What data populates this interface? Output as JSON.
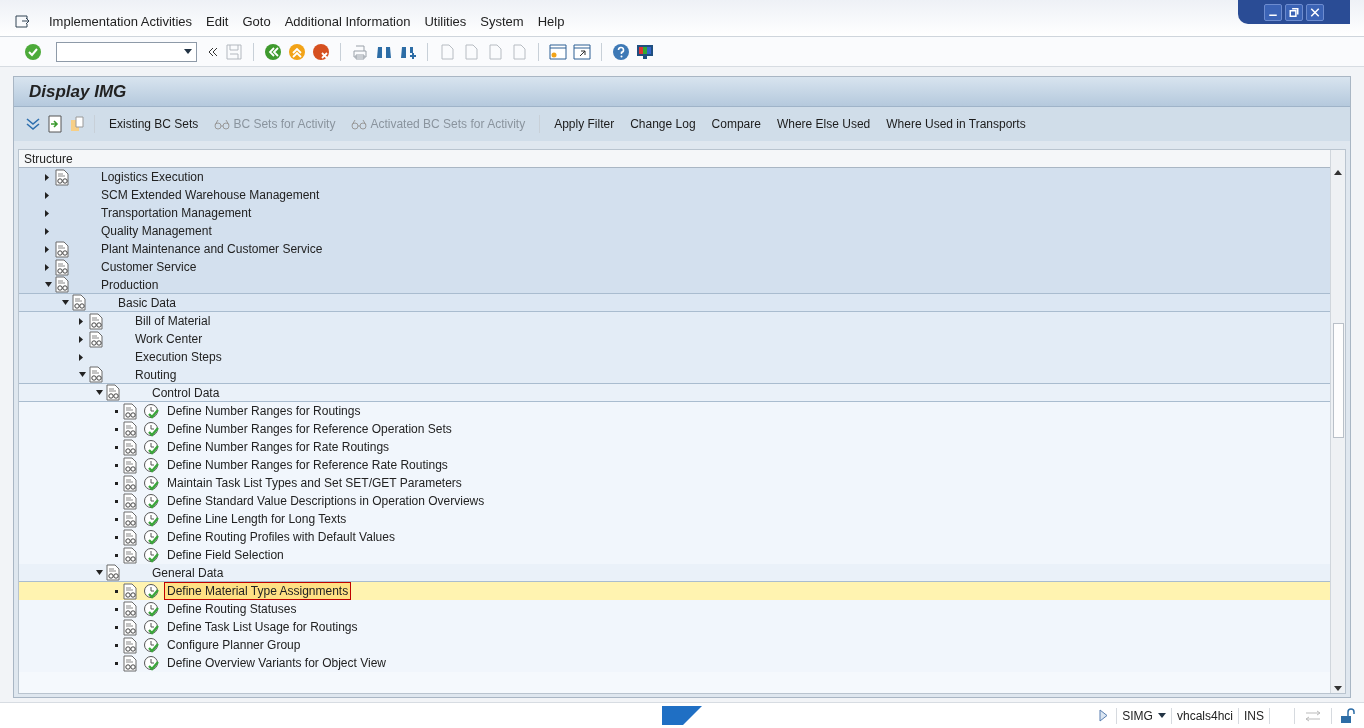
{
  "menu_bar": [
    "Implementation Activities",
    "Edit",
    "Goto",
    "Additional Information",
    "Utilities",
    "System",
    "Help"
  ],
  "screen_title": "Display IMG",
  "app_toolbar": [
    {
      "label": "Existing BC Sets",
      "disabled": false,
      "kind": "text"
    },
    {
      "label": "BC Sets for Activity",
      "disabled": true,
      "kind": "glasses"
    },
    {
      "label": "Activated BC Sets for Activity",
      "disabled": true,
      "kind": "glasses"
    },
    {
      "label": "Apply Filter",
      "disabled": false,
      "kind": "text"
    },
    {
      "label": "Change Log",
      "disabled": false,
      "kind": "text"
    },
    {
      "label": "Compare",
      "disabled": false,
      "kind": "text"
    },
    {
      "label": "Where Else Used",
      "disabled": false,
      "kind": "text"
    },
    {
      "label": "Where Used in Transports",
      "disabled": false,
      "kind": "text"
    }
  ],
  "tree": {
    "header": "Structure",
    "items": [
      {
        "label": "Logistics Execution",
        "kind": "folder",
        "documented": true,
        "expanded": false,
        "selected": false
      },
      {
        "label": "SCM Extended Warehouse Management",
        "kind": "folder",
        "documented": false,
        "expanded": false,
        "selected": false
      },
      {
        "label": "Transportation Management",
        "kind": "folder",
        "documented": false,
        "expanded": false,
        "selected": false
      },
      {
        "label": "Quality Management",
        "kind": "folder",
        "documented": false,
        "expanded": false,
        "selected": false
      },
      {
        "label": "Plant Maintenance and Customer Service",
        "kind": "folder",
        "documented": true,
        "expanded": false,
        "selected": false
      },
      {
        "label": "Customer Service",
        "kind": "folder",
        "documented": true,
        "expanded": false,
        "selected": false
      },
      {
        "label": "Production",
        "kind": "folder",
        "documented": true,
        "expanded": true,
        "selected": false,
        "children": [
          {
            "label": "Basic Data",
            "kind": "folder",
            "documented": true,
            "expanded": true,
            "selected": false,
            "children": [
              {
                "label": "Bill of Material",
                "kind": "folder",
                "documented": true,
                "expanded": false,
                "selected": false
              },
              {
                "label": "Work Center",
                "kind": "folder",
                "documented": true,
                "expanded": false,
                "selected": false
              },
              {
                "label": "Execution Steps",
                "kind": "folder",
                "documented": false,
                "expanded": false,
                "selected": false
              },
              {
                "label": "Routing",
                "kind": "folder",
                "documented": true,
                "expanded": true,
                "selected": false,
                "children": [
                  {
                    "label": "Control Data",
                    "kind": "folder",
                    "documented": true,
                    "expanded": true,
                    "selected": false,
                    "children": [
                      {
                        "label": "Define Number Ranges for Routings",
                        "kind": "activity",
                        "documented": true,
                        "selected": false
                      },
                      {
                        "label": "Define Number Ranges for Reference Operation Sets",
                        "kind": "activity",
                        "documented": true,
                        "selected": false
                      },
                      {
                        "label": "Define Number Ranges for Rate Routings",
                        "kind": "activity",
                        "documented": true,
                        "selected": false
                      },
                      {
                        "label": "Define Number Ranges for Reference Rate Routings",
                        "kind": "activity",
                        "documented": true,
                        "selected": false
                      },
                      {
                        "label": "Maintain Task List Types and Set SET/GET Parameters",
                        "kind": "activity",
                        "documented": true,
                        "selected": false
                      },
                      {
                        "label": "Define Standard Value Descriptions in Operation Overviews",
                        "kind": "activity",
                        "documented": true,
                        "selected": false
                      },
                      {
                        "label": "Define Line Length for Long Texts",
                        "kind": "activity",
                        "documented": true,
                        "selected": false
                      },
                      {
                        "label": "Define Routing Profiles with Default Values",
                        "kind": "activity",
                        "documented": true,
                        "selected": false
                      },
                      {
                        "label": "Define Field Selection",
                        "kind": "activity",
                        "documented": true,
                        "selected": false
                      }
                    ]
                  },
                  {
                    "label": "General Data",
                    "kind": "folder",
                    "documented": true,
                    "expanded": true,
                    "selected": false,
                    "children": [
                      {
                        "label": "Define Material Type Assignments",
                        "kind": "activity",
                        "documented": true,
                        "selected": true
                      },
                      {
                        "label": "Define Routing Statuses",
                        "kind": "activity",
                        "documented": true,
                        "selected": false
                      },
                      {
                        "label": "Define Task List Usage for Routings",
                        "kind": "activity",
                        "documented": true,
                        "selected": false
                      },
                      {
                        "label": "Configure Planner Group",
                        "kind": "activity",
                        "documented": true,
                        "selected": false
                      },
                      {
                        "label": "Define Overview Variants for Object View",
                        "kind": "activity",
                        "documented": true,
                        "selected": false
                      }
                    ]
                  }
                ]
              }
            ]
          }
        ]
      }
    ]
  },
  "status_bar": {
    "transaction": "SIMG",
    "server": "vhcals4hci",
    "mode": "INS"
  }
}
